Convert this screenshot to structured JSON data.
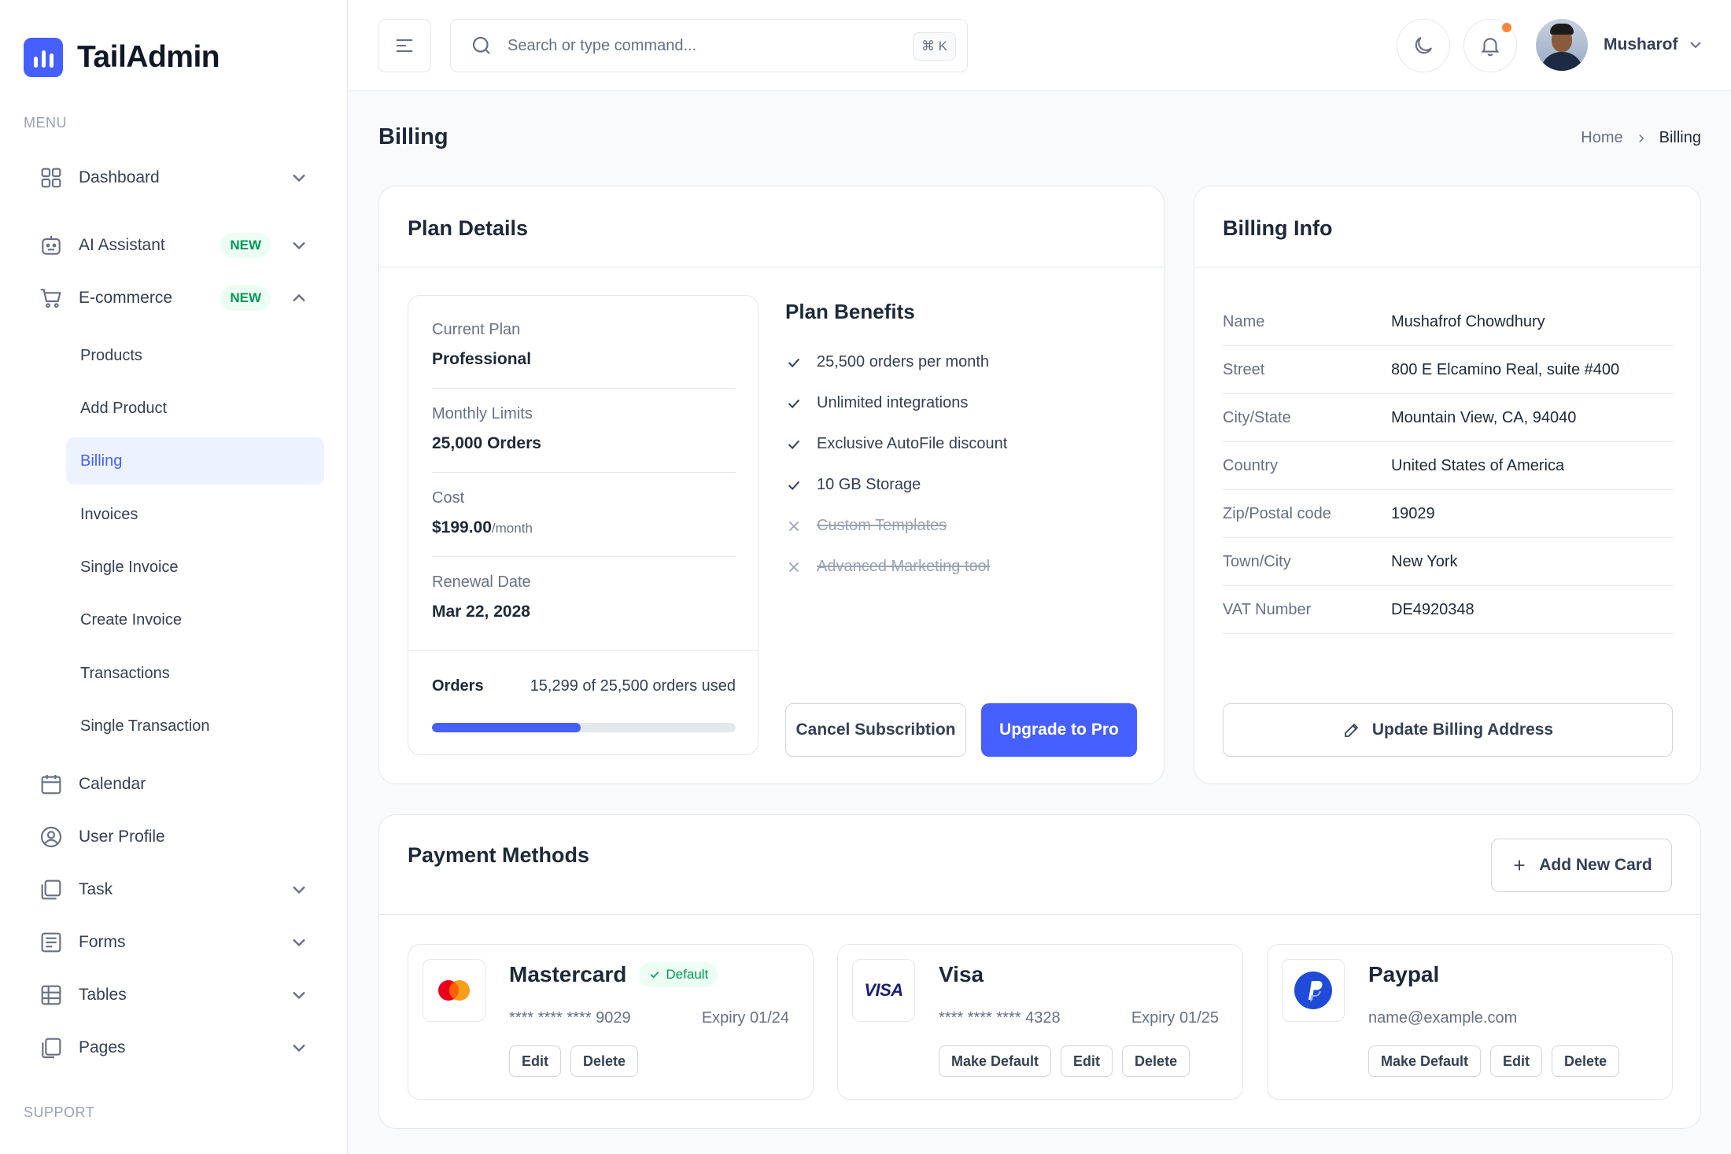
{
  "brand": {
    "name": "TailAdmin",
    "accent": "#465fff"
  },
  "sidebar": {
    "menu_heading": "MENU",
    "support_heading": "SUPPORT",
    "items": [
      {
        "label": "Dashboard",
        "icon": "grid-icon"
      },
      {
        "label": "AI Assistant",
        "icon": "robot-icon",
        "badge": "NEW"
      },
      {
        "label": "E-commerce",
        "icon": "cart-icon",
        "badge": "NEW"
      },
      {
        "label": "Calendar",
        "icon": "calendar-icon"
      },
      {
        "label": "User Profile",
        "icon": "user-circle-icon"
      },
      {
        "label": "Task",
        "icon": "task-icon"
      },
      {
        "label": "Forms",
        "icon": "form-icon"
      },
      {
        "label": "Tables",
        "icon": "table-icon"
      },
      {
        "label": "Pages",
        "icon": "pages-icon"
      }
    ],
    "ecommerce_sub": [
      "Products",
      "Add Product",
      "Billing",
      "Invoices",
      "Single Invoice",
      "Create Invoice",
      "Transactions",
      "Single Transaction"
    ],
    "active_sub": "Billing"
  },
  "header": {
    "search_placeholder": "Search or type command...",
    "search_shortcut": "⌘ K",
    "user_name": "Musharof"
  },
  "page": {
    "title": "Billing",
    "breadcrumb_home": "Home",
    "breadcrumb_current": "Billing"
  },
  "plan": {
    "title": "Plan Details",
    "current_plan_label": "Current Plan",
    "current_plan": "Professional",
    "monthly_limits_label": "Monthly Limits",
    "monthly_limits": "25,000 Orders",
    "cost_label": "Cost",
    "cost": "$199.00",
    "cost_period": "/month",
    "renewal_label": "Renewal Date",
    "renewal": "Mar 22, 2028",
    "orders_label": "Orders",
    "orders_used": "15,299 of 25,500 orders used",
    "orders_progress": 0.49,
    "benefits_title": "Plan Benefits",
    "benefits": [
      {
        "text": "25,500 orders per month",
        "included": true
      },
      {
        "text": "Unlimited integrations",
        "included": true
      },
      {
        "text": "Exclusive AutoFile discount",
        "included": true
      },
      {
        "text": "10 GB Storage",
        "included": true
      },
      {
        "text": "Custom Templates",
        "included": false
      },
      {
        "text": "Advanced Marketing tool",
        "included": false
      }
    ],
    "cancel_label": "Cancel Subscribtion",
    "upgrade_label": "Upgrade to Pro"
  },
  "billing_info": {
    "title": "Billing Info",
    "rows": [
      {
        "label": "Name",
        "value": "Mushafrof Chowdhury"
      },
      {
        "label": "Street",
        "value": "800 E Elcamino Real, suite #400"
      },
      {
        "label": "City/State",
        "value": "Mountain View, CA, 94040"
      },
      {
        "label": "Country",
        "value": "United States of America"
      },
      {
        "label": "Zip/Postal code",
        "value": "19029"
      },
      {
        "label": "Town/City",
        "value": "New York"
      },
      {
        "label": "VAT Number",
        "value": "DE4920348"
      }
    ],
    "update_label": "Update Billing Address"
  },
  "payment": {
    "title": "Payment Methods",
    "add_label": "Add New Card",
    "default_badge": "Default",
    "make_default_label": "Make Default",
    "edit_label": "Edit",
    "delete_label": "Delete",
    "cards": [
      {
        "name": "Mastercard",
        "number": "**** **** **** 9029",
        "expiry": "Expiry 01/24",
        "is_default": true
      },
      {
        "name": "Visa",
        "number": "**** **** **** 4328",
        "expiry": "Expiry 01/25",
        "is_default": false,
        "logo_text": "VISA"
      },
      {
        "name": "Paypal",
        "email": "name@example.com",
        "is_default": false
      }
    ]
  }
}
